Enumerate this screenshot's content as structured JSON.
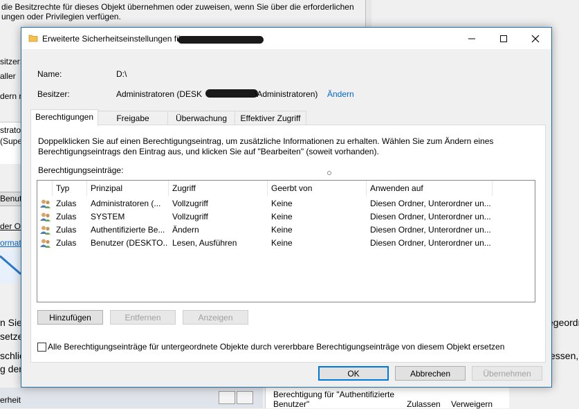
{
  "background": {
    "line1": "die Besitzrechte für dieses Objekt übernehmen oder zuweisen, wenn Sie über die erforderlichen",
    "line2": "ungen oder Privilegien verfügen.",
    "frag_sitzer": "sitzer:",
    "frag_aller": "aller",
    "frag_dern": "dern na",
    "frag_strat": "strato",
    "frag_super": "(Super",
    "frag_benutz": "Benutz",
    "frag_der_ob": "der Ob",
    "frag_format": "ormatio",
    "frag_nsie": "n Sie",
    "frag_setzen": "setzen",
    "frag_schlie": "schlie",
    "frag_g_der": "g der",
    "frag_erheit": "erheit",
    "frag_egeordn": "egeordn",
    "frag_essen": "essen, b",
    "bottom_perm1": "Berechtigung für \"Authentifizierte",
    "bottom_perm2": "Benutzer\"",
    "bottom_zulassen": "Zulassen",
    "bottom_verweigern": "Verweigern"
  },
  "dialog": {
    "title": "Erweiterte Sicherheitseinstellungen für",
    "name_label": "Name:",
    "name_value": "D:\\",
    "owner_label": "Besitzer:",
    "owner_prefix": "Administratoren (DESK",
    "owner_suffix": "\\Administratoren)",
    "owner_change": "Ändern",
    "tabs": [
      {
        "label": "Berechtigungen"
      },
      {
        "label": "Freigabe"
      },
      {
        "label": "Überwachung"
      },
      {
        "label": "Effektiver Zugriff"
      }
    ],
    "description": "Doppelklicken Sie auf einen Berechtigungseintrag, um zusätzliche Informationen zu erhalten. Wählen Sie zum Ändern eines Berechtigungseintrags den Eintrag aus, und klicken Sie auf \"Bearbeiten\" (soweit vorhanden).",
    "entries_label": "Berechtigungseinträge:",
    "columns": [
      "Typ",
      "Prinzipal",
      "Zugriff",
      "Geerbt von",
      "Anwenden auf"
    ],
    "rows": [
      {
        "typ": "Zulas",
        "prinzipal": "Administratoren (...",
        "zugriff": "Vollzugriff",
        "geerbt": "Keine",
        "anwenden": "Diesen Ordner, Unterordner un..."
      },
      {
        "typ": "Zulas",
        "prinzipal": "SYSTEM",
        "zugriff": "Vollzugriff",
        "geerbt": "Keine",
        "anwenden": "Diesen Ordner, Unterordner un..."
      },
      {
        "typ": "Zulas",
        "prinzipal": "Authentifizierte Be...",
        "zugriff": "Ändern",
        "geerbt": "Keine",
        "anwenden": "Diesen Ordner, Unterordner un..."
      },
      {
        "typ": "Zulas",
        "prinzipal": "Benutzer (DESKTO...",
        "zugriff": "Lesen, Ausführen",
        "geerbt": "Keine",
        "anwenden": "Diesen Ordner, Unterordner un..."
      }
    ],
    "btn_add": "Hinzufügen",
    "btn_remove": "Entfernen",
    "btn_view": "Anzeigen",
    "replace_label": "Alle Berechtigungseinträge für untergeordnete Objekte durch vererbbare Berechtigungseinträge von diesem Objekt ersetzen",
    "btn_ok": "OK",
    "btn_cancel": "Abbrechen",
    "btn_apply": "Übernehmen"
  },
  "colors": {
    "accent": "#0078d7",
    "link": "#0066cc",
    "window_border": "#1f6fb5"
  }
}
